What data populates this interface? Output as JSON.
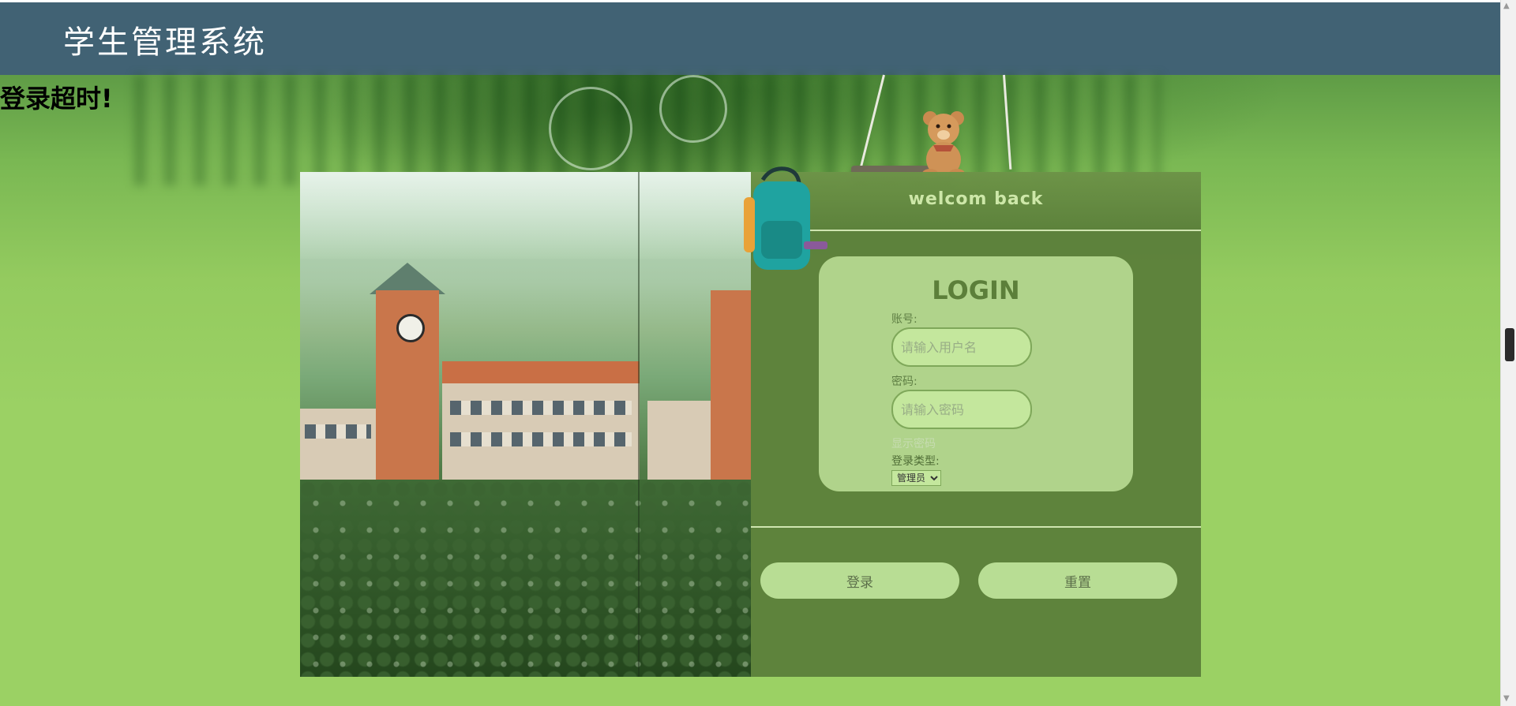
{
  "header": {
    "title": "学生管理系统"
  },
  "alert": {
    "message": "登录超时!"
  },
  "login_panel": {
    "welcome_text": "welcom back",
    "title": "LOGIN",
    "account": {
      "label": "账号:",
      "placeholder": "请输入用户名",
      "value": ""
    },
    "password": {
      "label": "密码:",
      "placeholder": "请输入密码",
      "value": ""
    },
    "show_password_label": "显示密码",
    "login_type": {
      "label": "登录类型:",
      "selected": "管理员"
    },
    "buttons": {
      "login": "登录",
      "reset": "重置"
    }
  },
  "icons": [
    "backpack-icon",
    "teddy-bear-icon",
    "swing-decoration",
    "clock-icon"
  ],
  "colors": {
    "header_bg": "#416274",
    "page_bg": "#9bd164",
    "panel_bg": "#5c803b",
    "card_bg": "#b0d38b",
    "button_bg": "#b8dd94",
    "welcome_text": "#cde7a8"
  }
}
